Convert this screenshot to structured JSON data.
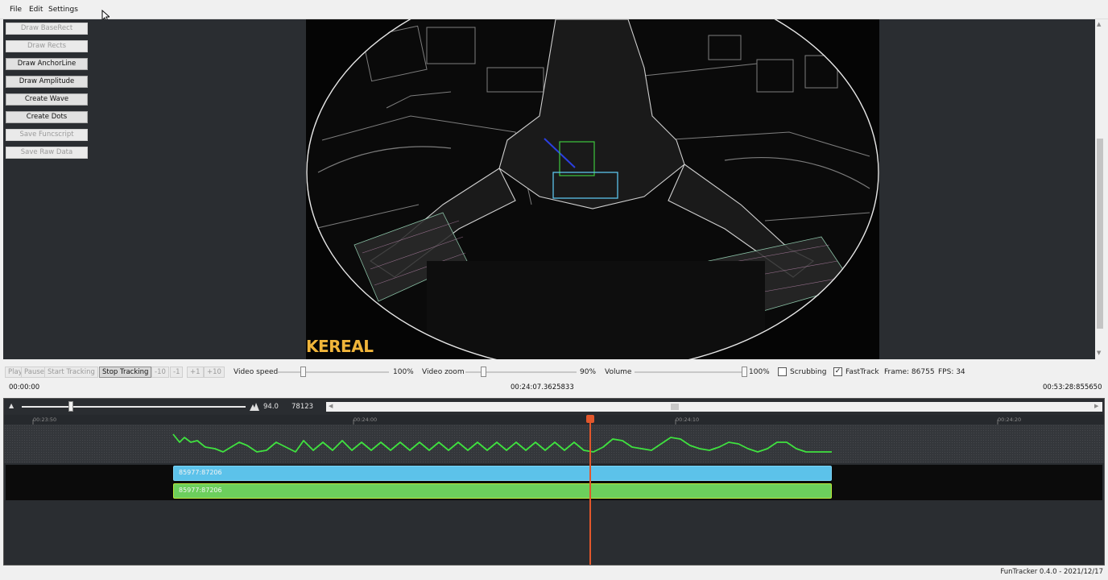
{
  "menu": {
    "file": "File",
    "edit": "Edit",
    "settings": "Settings"
  },
  "tools": {
    "draw_baserect": "Draw BaseRect",
    "draw_rects": "Draw Rects",
    "draw_anchorline": "Draw AnchorLine",
    "draw_amplitude": "Draw Amplitude",
    "create_wave": "Create Wave",
    "create_dots": "Create Dots",
    "save_funcscript": "Save Funcscript",
    "save_raw_data": "Save Raw Data"
  },
  "video": {
    "watermark": "KEREAL"
  },
  "controls": {
    "play": "Play",
    "pause": "Pause",
    "start_tracking": "Start Tracking",
    "stop_tracking": "Stop Tracking",
    "minus10": "-10",
    "minus1": "-1",
    "plus1": "+1",
    "plus10": "+10",
    "video_speed_label": "Video speed",
    "video_speed_value": "100%",
    "video_speed": 1.0,
    "video_zoom_label": "Video zoom",
    "video_zoom_value": "90%",
    "video_zoom": 0.9,
    "volume_label": "Volume",
    "volume_value": "100%",
    "volume": 1.0,
    "scrubbing_label": "Scrubbing",
    "scrubbing_checked": false,
    "fasttrack_label": "FastTrack",
    "fasttrack_checked": true,
    "frame_text": "Frame: 86755",
    "fps_text": "FPS: 34",
    "time_start": "00:00:00",
    "time_current": "00:24:07.3625833",
    "time_end": "00:53:28:855650"
  },
  "timeline": {
    "zoom_value": "94.0",
    "frame_count": "78123",
    "ticks": [
      "00:23:50",
      "00:24:00",
      "00:24:10",
      "00:24:20"
    ],
    "bars": [
      {
        "label": "85977:87206",
        "color": "#5cc2ea"
      },
      {
        "label": "85977:87206",
        "color": "#6ccf5c"
      }
    ]
  },
  "status": {
    "version": "FunTracker 0.4.0 - 2021/12/17"
  }
}
